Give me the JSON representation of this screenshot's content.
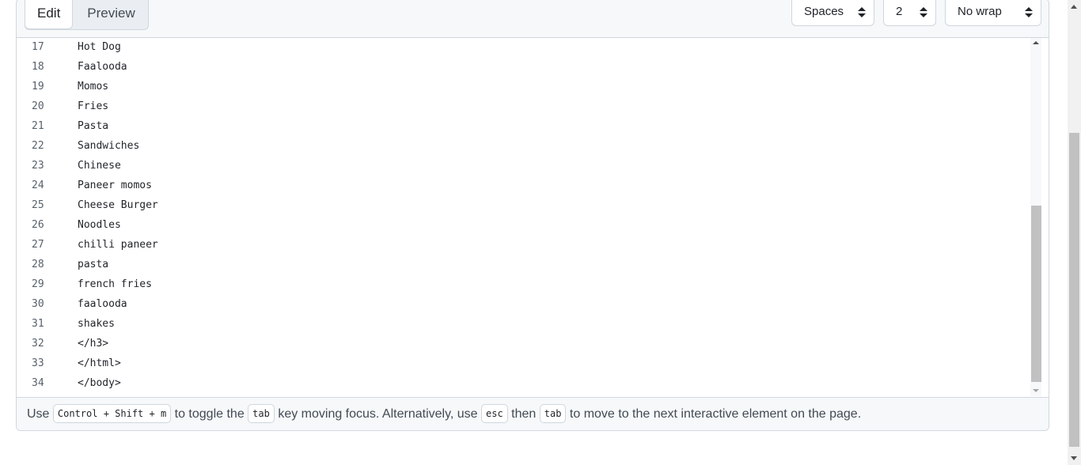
{
  "toolbar": {
    "tabs": [
      {
        "label": "Edit",
        "active": true
      },
      {
        "label": "Preview",
        "active": false
      }
    ],
    "indent_mode": "Spaces",
    "indent_size": "2",
    "wrap_mode": "No wrap"
  },
  "code_lines": [
    {
      "num": "17",
      "text": "Hot Dog"
    },
    {
      "num": "18",
      "text": "Faalooda"
    },
    {
      "num": "19",
      "text": "Momos"
    },
    {
      "num": "20",
      "text": "Fries"
    },
    {
      "num": "21",
      "text": "Pasta"
    },
    {
      "num": "22",
      "text": "Sandwiches"
    },
    {
      "num": "23",
      "text": "Chinese"
    },
    {
      "num": "24",
      "text": "Paneer momos"
    },
    {
      "num": "25",
      "text": "Cheese Burger"
    },
    {
      "num": "26",
      "text": "Noodles"
    },
    {
      "num": "27",
      "text": "chilli paneer"
    },
    {
      "num": "28",
      "text": "pasta"
    },
    {
      "num": "29",
      "text": "french fries"
    },
    {
      "num": "30",
      "text": "faalooda"
    },
    {
      "num": "31",
      "text": "shakes"
    },
    {
      "num": "32",
      "text": "</h3>"
    },
    {
      "num": "33",
      "text": "</html>"
    },
    {
      "num": "34",
      "text": "</body>"
    }
  ],
  "footer": {
    "use": "Use",
    "shortcut_key": "Control + Shift + m",
    "text_toggle": "to toggle the",
    "tab_key": "tab",
    "text_moving": "key moving focus. Alternatively, use",
    "esc_key": "esc",
    "text_then": "then",
    "tab_key_2": "tab",
    "text_end": "to move to the next interactive element on the page."
  }
}
